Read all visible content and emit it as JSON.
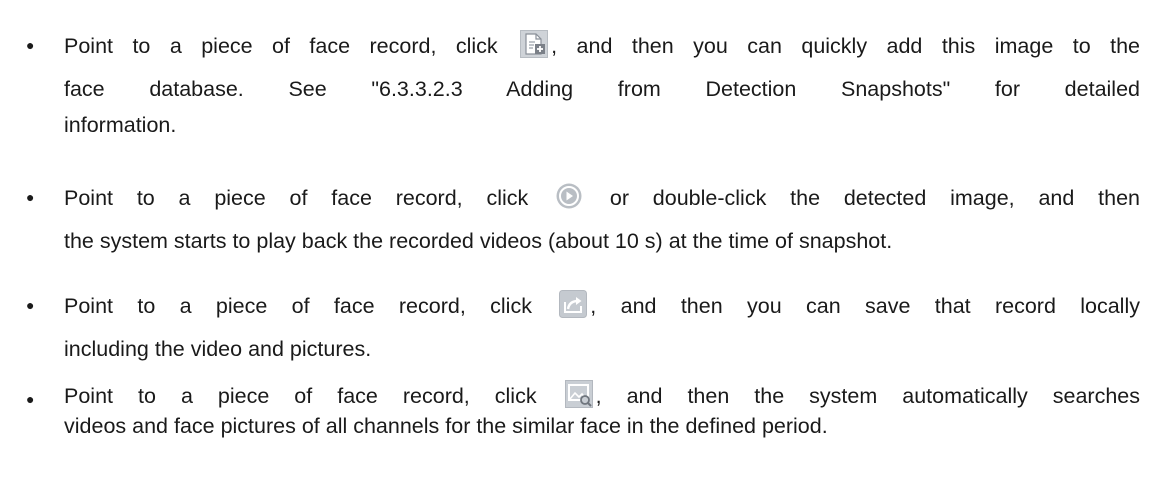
{
  "items": [
    {
      "lines": [
        {
          "before": "Point to a piece of face record, click ",
          "icon": "add-to-database-icon",
          "after": ", and then you can quickly add this image to the"
        },
        {
          "text": "face database. See \"6.3.3.2.3 Adding from Detection Snapshots\" for detailed"
        },
        {
          "text": "information."
        }
      ]
    },
    {
      "lines": [
        {
          "before": "Point to a piece of face record, click ",
          "icon": "play-icon",
          "after": " or double-click the detected image, and then"
        },
        {
          "text": "the system starts to play back the recorded videos (about 10 s) at the time of snapshot."
        }
      ]
    },
    {
      "lines": [
        {
          "before": "Point to a piece of face record, click ",
          "icon": "export-icon",
          "after": ", and then you can save that record locally"
        },
        {
          "text": "including the video and pictures."
        }
      ]
    },
    {
      "lines": [
        {
          "before": "Point to a piece of face record, click ",
          "icon": "search-by-image-icon",
          "after": ", and then the system automatically searches"
        },
        {
          "text": "videos and face pictures of all channels for the similar face in the defined period."
        }
      ]
    }
  ],
  "bullet_char": "●"
}
